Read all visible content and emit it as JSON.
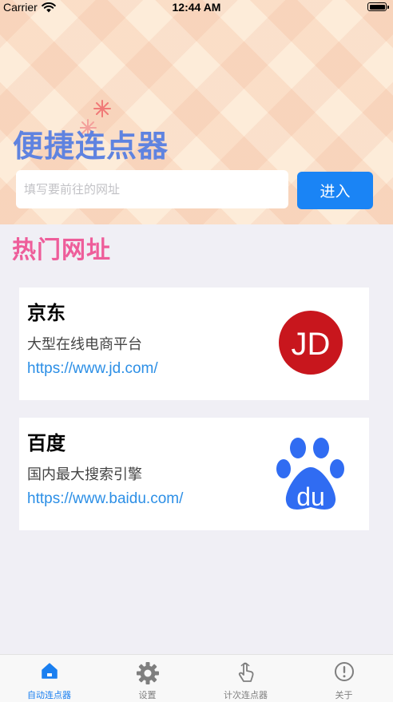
{
  "status_bar": {
    "carrier": "Carrier",
    "time": "12:44 AM"
  },
  "header": {
    "title": "便捷连点器",
    "url_input": {
      "value": "",
      "placeholder": "填写要前往的网址"
    },
    "enter_label": "进入"
  },
  "section": {
    "title": "热门网址"
  },
  "sites": [
    {
      "name": "京东",
      "desc": "大型在线电商平台",
      "url": "https://www.jd.com/",
      "logo_text": "JD",
      "logo_color": "#c8161d"
    },
    {
      "name": "百度",
      "desc": "国内最大搜索引擎",
      "url": "https://www.baidu.com/",
      "logo_text": "du",
      "logo_color": "#306cf2"
    }
  ],
  "tabs": [
    {
      "label": "自动连点器",
      "icon": "home-icon",
      "active": true
    },
    {
      "label": "设置",
      "icon": "gear-icon",
      "active": false
    },
    {
      "label": "计次连点器",
      "icon": "finger-tap-icon",
      "active": false
    },
    {
      "label": "关于",
      "icon": "info-icon",
      "active": false
    }
  ],
  "colors": {
    "accent": "#1a84f5",
    "title": "#5f83e0",
    "section_title": "#ee5d9a",
    "link": "#2c8fe6",
    "tab_active": "#1a7ff0",
    "tab_inactive": "#7f7f7f"
  }
}
